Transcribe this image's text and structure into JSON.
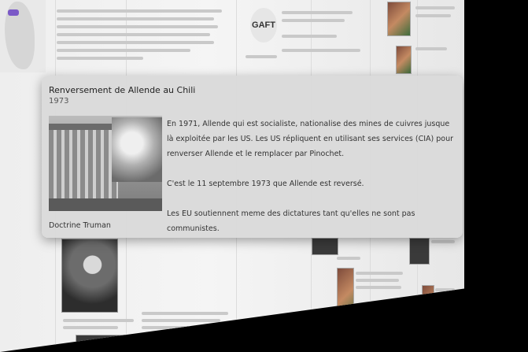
{
  "timeline": {
    "logo_text": "GAFT"
  },
  "card": {
    "title": "Renversement de Allende au Chili",
    "year": "1973",
    "paragraphs": [
      "En 1971, Allende qui est socialiste, nationalise des mines de cuivres jusque là exploitée par les US. Les US répliquent en utilisant ses services (CIA) pour renverser Allende et le remplacer par Pinochet.",
      "C'est le 11 septembre 1973 que Allende est reversé.",
      "Les EU soutiennent meme des dictatures tant qu'elles ne sont pas communistes."
    ],
    "footer": "Doctrine Truman"
  }
}
